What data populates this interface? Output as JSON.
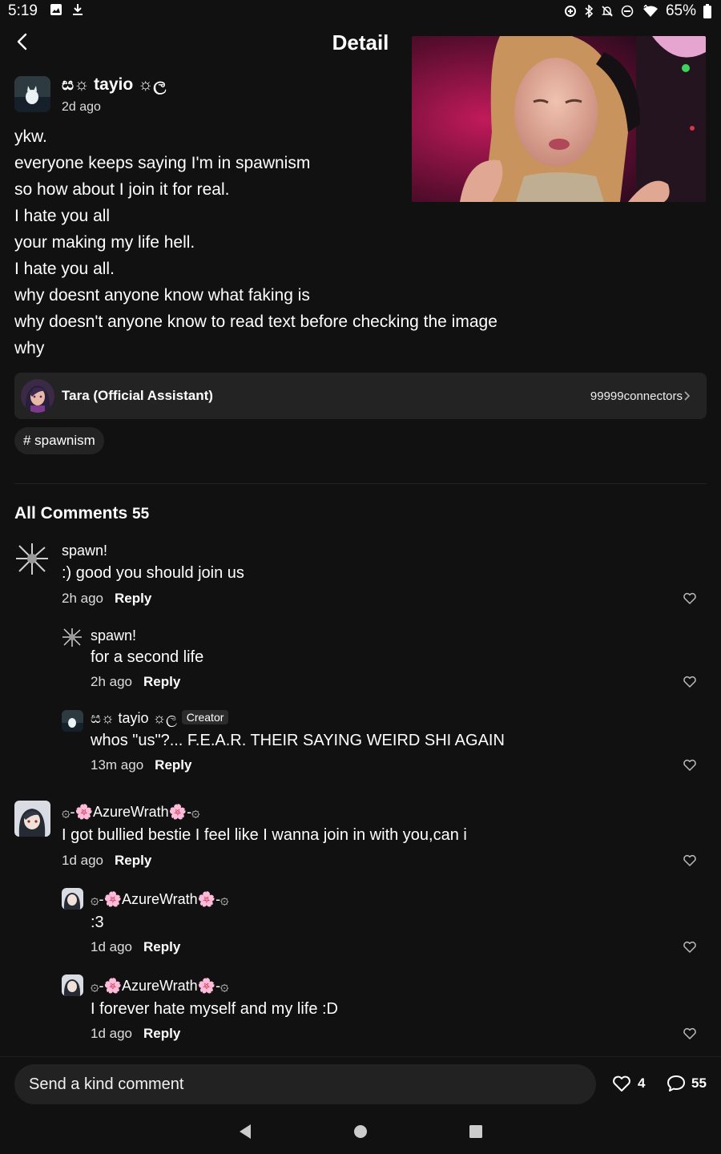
{
  "status_bar": {
    "time": "5:19",
    "battery": "65%",
    "left_icons": [
      "image-icon",
      "download-icon"
    ],
    "right_icons": [
      "data-saver-icon",
      "bluetooth-icon",
      "mute-icon",
      "dnd-icon",
      "wifi-icon",
      "battery-icon"
    ]
  },
  "header": {
    "title": "Detail"
  },
  "post": {
    "author": "ස☼ tayio ☼ල",
    "time": "2d ago",
    "lines": [
      "ykw.",
      "everyone keeps saying I'm in spawnism",
      "so how about I join it for real.",
      "I hate you all",
      "your making my life hell.",
      "I hate you all.",
      "why doesnt anyone know what faking is",
      "why doesn't anyone know to read text before checking the image",
      "why"
    ]
  },
  "assistant": {
    "name": "Tara (Official Assistant)",
    "connectors": "99999connectors"
  },
  "hashtag": "# spawnism",
  "comments_section": {
    "title": "All Comments",
    "count": "55",
    "comments": [
      {
        "author": "spawn!",
        "text": ":) good you should join us",
        "time": "2h ago",
        "reply": "Reply"
      },
      {
        "author": "spawn!",
        "text": "for a second life",
        "time": "2h ago",
        "reply": "Reply"
      },
      {
        "author": "ස☼ tayio ☼ල",
        "badge": "Creator",
        "text": "whos \"us\"?... F.E.A.R. THEIR SAYING WEIRD SHI AGAIN",
        "time": "13m ago",
        "reply": "Reply"
      },
      {
        "author": "۞-🌸AzureWrath🌸-۞",
        "text": "I got bullied bestie I feel like I wanna join in with you,can i",
        "time": "1d ago",
        "reply": "Reply"
      },
      {
        "author": "۞-🌸AzureWrath🌸-۞",
        "text": ":3",
        "time": "1d ago",
        "reply": "Reply"
      },
      {
        "author": "۞-🌸AzureWrath🌸-۞",
        "text": "I forever hate myself and my life :D",
        "time": "1d ago",
        "reply": "Reply"
      }
    ]
  },
  "bottom_bar": {
    "placeholder": "Send a kind comment",
    "likes": "4",
    "comments": "55"
  },
  "colors": {
    "background": "#111111",
    "card": "#232323",
    "input": "#222222",
    "text": "#ffffff"
  }
}
